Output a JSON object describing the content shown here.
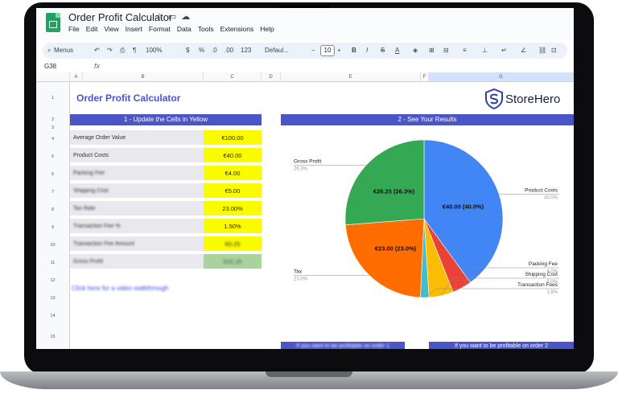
{
  "window": {
    "doc_title": "Order Profit Calculator",
    "menu": [
      "File",
      "Edit",
      "View",
      "Insert",
      "Format",
      "Data",
      "Tools",
      "Extensions",
      "Help"
    ]
  },
  "toolbar": {
    "menus_label": "Menus",
    "zoom": "100%",
    "currency": "$",
    "percent": "%",
    "decrease_decimal": ".0",
    "increase_decimal": ".00",
    "number_format": "123",
    "font": "Defaul...",
    "font_size": "10",
    "bold": "B",
    "italic": "I",
    "strike": "S",
    "text_color": "A"
  },
  "formula_bar": {
    "name_box": "G38",
    "fx": "fx"
  },
  "columns": [
    "A",
    "B",
    "C",
    "D",
    "E",
    "F",
    "G"
  ],
  "rows": [
    "1",
    "2",
    "3",
    "4",
    "5",
    "6",
    "7",
    "8",
    "9",
    "10",
    "11",
    "12",
    "13",
    "14",
    "15"
  ],
  "sheet": {
    "title": "Order Profit Calculator",
    "section1": "1 - Update the Cells in Yellow",
    "section2": "2 - See Your Results",
    "inputs": [
      {
        "label": "Average Order Value",
        "value": "€100.00"
      },
      {
        "label": "Product Costs",
        "value": "€40.00"
      },
      {
        "label": "Packing Fee",
        "value": "€4.00"
      },
      {
        "label": "Shipping Cost",
        "value": "€5.00"
      },
      {
        "label": "Tax Rate",
        "value": "23.00%"
      },
      {
        "label": "Transaction Fee %",
        "value": "1.50%"
      },
      {
        "label": "Transaction Fee Amount",
        "value": "€0.25"
      },
      {
        "label": "Gross Profit",
        "value": "€26.25"
      }
    ],
    "walkthrough_link": "Click here for a video walkthrough",
    "footer_left": "If you want to be profitable on order 1",
    "footer_right": "If you want to be profitable on order 2"
  },
  "brand": {
    "name": "StoreHero"
  },
  "colors": {
    "section_bar": "#4a55c8",
    "input_yellow": "#fbfb00",
    "gross_profit_green": "#a9d39b"
  },
  "chart_data": {
    "type": "pie",
    "slices": [
      {
        "name": "Product Costs",
        "value": 40.0,
        "percent_label": "40.0%",
        "inner_label": "€40.00 (40.0%)",
        "color": "#4285f4"
      },
      {
        "name": "Packing Fee",
        "value": 4.0,
        "percent_label": "4.0%",
        "inner_label": "",
        "color": "#ea4335"
      },
      {
        "name": "Shipping Cost",
        "value": 5.0,
        "percent_label": "5.0%",
        "inner_label": "",
        "color": "#fbbc04"
      },
      {
        "name": "Transaction Fees",
        "value": 1.75,
        "percent_label": "1.8%",
        "inner_label": "",
        "color": "#46bdc6"
      },
      {
        "name": "Tax",
        "value": 23.0,
        "percent_label": "23.0%",
        "inner_label": "€23.00 (23.0%)",
        "color": "#ff6d01"
      },
      {
        "name": "Gross Profit",
        "value": 26.25,
        "percent_label": "26.3%",
        "inner_label": "€26.25 (26.3%)",
        "color": "#34a853"
      }
    ]
  }
}
